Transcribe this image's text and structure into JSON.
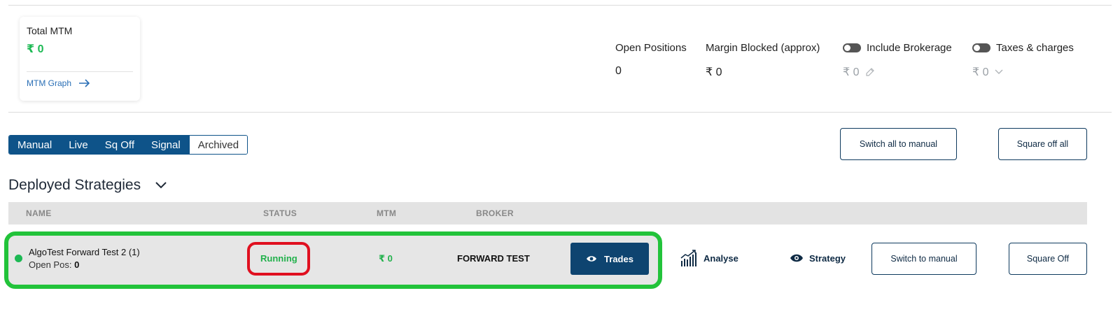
{
  "mtm_card": {
    "label": "Total MTM",
    "value": "₹ 0",
    "link_label": "MTM Graph"
  },
  "summary": {
    "open_positions": {
      "label": "Open Positions",
      "value": "0"
    },
    "margin_blocked": {
      "label": "Margin Blocked (approx)",
      "value": "₹ 0"
    },
    "include_brokerage": {
      "label": "Include Brokerage",
      "value": "₹ 0",
      "enabled": false
    },
    "taxes_charges": {
      "label": "Taxes & charges",
      "value": "₹ 0",
      "enabled": false
    }
  },
  "tabs": [
    {
      "label": "Manual",
      "active": true
    },
    {
      "label": "Live",
      "active": true
    },
    {
      "label": "Sq Off",
      "active": true
    },
    {
      "label": "Signal",
      "active": true
    },
    {
      "label": "Archived",
      "active": false
    }
  ],
  "actions": {
    "switch_all_label": "Switch all to manual",
    "square_off_all_label": "Square off all"
  },
  "section": {
    "title": "Deployed Strategies"
  },
  "table": {
    "columns": [
      "NAME",
      "STATUS",
      "MTM",
      "BROKER"
    ],
    "rows": [
      {
        "name": "AlgoTest Forward Test 2 (1)",
        "open_pos_label": "Open Pos:",
        "open_pos_value": "0",
        "status": "Running",
        "mtm": "₹ 0",
        "broker": "FORWARD TEST",
        "trades_label": "Trades",
        "analyse_label": "Analyse",
        "strategy_label": "Strategy",
        "switch_manual_label": "Switch to manual",
        "square_off_label": "Square Off"
      }
    ]
  },
  "colors": {
    "primary": "#0e5389",
    "positive": "#22b14c",
    "highlight_green": "#22c33a",
    "highlight_red": "#e01020"
  }
}
